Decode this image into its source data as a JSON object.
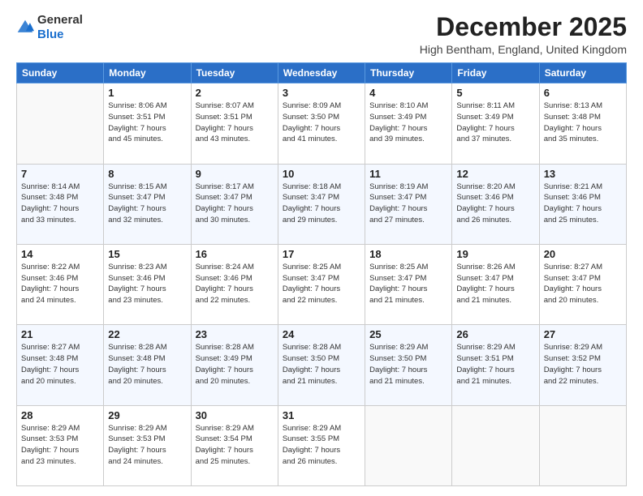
{
  "logo": {
    "general": "General",
    "blue": "Blue"
  },
  "header": {
    "month": "December 2025",
    "location": "High Bentham, England, United Kingdom"
  },
  "weekdays": [
    "Sunday",
    "Monday",
    "Tuesday",
    "Wednesday",
    "Thursday",
    "Friday",
    "Saturday"
  ],
  "weeks": [
    [
      {
        "day": "",
        "info": ""
      },
      {
        "day": "1",
        "info": "Sunrise: 8:06 AM\nSunset: 3:51 PM\nDaylight: 7 hours\nand 45 minutes."
      },
      {
        "day": "2",
        "info": "Sunrise: 8:07 AM\nSunset: 3:51 PM\nDaylight: 7 hours\nand 43 minutes."
      },
      {
        "day": "3",
        "info": "Sunrise: 8:09 AM\nSunset: 3:50 PM\nDaylight: 7 hours\nand 41 minutes."
      },
      {
        "day": "4",
        "info": "Sunrise: 8:10 AM\nSunset: 3:49 PM\nDaylight: 7 hours\nand 39 minutes."
      },
      {
        "day": "5",
        "info": "Sunrise: 8:11 AM\nSunset: 3:49 PM\nDaylight: 7 hours\nand 37 minutes."
      },
      {
        "day": "6",
        "info": "Sunrise: 8:13 AM\nSunset: 3:48 PM\nDaylight: 7 hours\nand 35 minutes."
      }
    ],
    [
      {
        "day": "7",
        "info": "Sunrise: 8:14 AM\nSunset: 3:48 PM\nDaylight: 7 hours\nand 33 minutes."
      },
      {
        "day": "8",
        "info": "Sunrise: 8:15 AM\nSunset: 3:47 PM\nDaylight: 7 hours\nand 32 minutes."
      },
      {
        "day": "9",
        "info": "Sunrise: 8:17 AM\nSunset: 3:47 PM\nDaylight: 7 hours\nand 30 minutes."
      },
      {
        "day": "10",
        "info": "Sunrise: 8:18 AM\nSunset: 3:47 PM\nDaylight: 7 hours\nand 29 minutes."
      },
      {
        "day": "11",
        "info": "Sunrise: 8:19 AM\nSunset: 3:47 PM\nDaylight: 7 hours\nand 27 minutes."
      },
      {
        "day": "12",
        "info": "Sunrise: 8:20 AM\nSunset: 3:46 PM\nDaylight: 7 hours\nand 26 minutes."
      },
      {
        "day": "13",
        "info": "Sunrise: 8:21 AM\nSunset: 3:46 PM\nDaylight: 7 hours\nand 25 minutes."
      }
    ],
    [
      {
        "day": "14",
        "info": "Sunrise: 8:22 AM\nSunset: 3:46 PM\nDaylight: 7 hours\nand 24 minutes."
      },
      {
        "day": "15",
        "info": "Sunrise: 8:23 AM\nSunset: 3:46 PM\nDaylight: 7 hours\nand 23 minutes."
      },
      {
        "day": "16",
        "info": "Sunrise: 8:24 AM\nSunset: 3:46 PM\nDaylight: 7 hours\nand 22 minutes."
      },
      {
        "day": "17",
        "info": "Sunrise: 8:25 AM\nSunset: 3:47 PM\nDaylight: 7 hours\nand 22 minutes."
      },
      {
        "day": "18",
        "info": "Sunrise: 8:25 AM\nSunset: 3:47 PM\nDaylight: 7 hours\nand 21 minutes."
      },
      {
        "day": "19",
        "info": "Sunrise: 8:26 AM\nSunset: 3:47 PM\nDaylight: 7 hours\nand 21 minutes."
      },
      {
        "day": "20",
        "info": "Sunrise: 8:27 AM\nSunset: 3:47 PM\nDaylight: 7 hours\nand 20 minutes."
      }
    ],
    [
      {
        "day": "21",
        "info": "Sunrise: 8:27 AM\nSunset: 3:48 PM\nDaylight: 7 hours\nand 20 minutes."
      },
      {
        "day": "22",
        "info": "Sunrise: 8:28 AM\nSunset: 3:48 PM\nDaylight: 7 hours\nand 20 minutes."
      },
      {
        "day": "23",
        "info": "Sunrise: 8:28 AM\nSunset: 3:49 PM\nDaylight: 7 hours\nand 20 minutes."
      },
      {
        "day": "24",
        "info": "Sunrise: 8:28 AM\nSunset: 3:50 PM\nDaylight: 7 hours\nand 21 minutes."
      },
      {
        "day": "25",
        "info": "Sunrise: 8:29 AM\nSunset: 3:50 PM\nDaylight: 7 hours\nand 21 minutes."
      },
      {
        "day": "26",
        "info": "Sunrise: 8:29 AM\nSunset: 3:51 PM\nDaylight: 7 hours\nand 21 minutes."
      },
      {
        "day": "27",
        "info": "Sunrise: 8:29 AM\nSunset: 3:52 PM\nDaylight: 7 hours\nand 22 minutes."
      }
    ],
    [
      {
        "day": "28",
        "info": "Sunrise: 8:29 AM\nSunset: 3:53 PM\nDaylight: 7 hours\nand 23 minutes."
      },
      {
        "day": "29",
        "info": "Sunrise: 8:29 AM\nSunset: 3:53 PM\nDaylight: 7 hours\nand 24 minutes."
      },
      {
        "day": "30",
        "info": "Sunrise: 8:29 AM\nSunset: 3:54 PM\nDaylight: 7 hours\nand 25 minutes."
      },
      {
        "day": "31",
        "info": "Sunrise: 8:29 AM\nSunset: 3:55 PM\nDaylight: 7 hours\nand 26 minutes."
      },
      {
        "day": "",
        "info": ""
      },
      {
        "day": "",
        "info": ""
      },
      {
        "day": "",
        "info": ""
      }
    ]
  ]
}
